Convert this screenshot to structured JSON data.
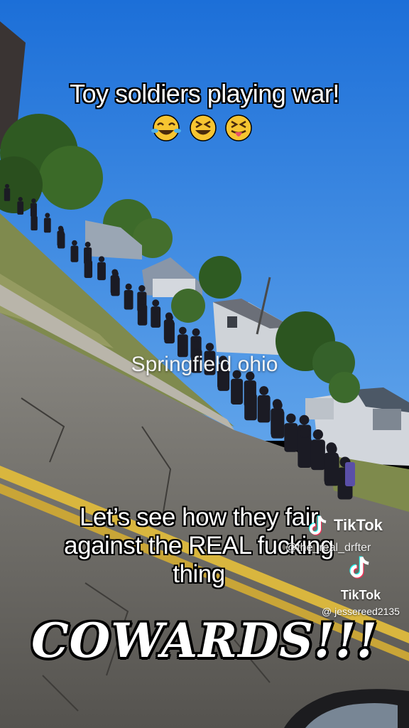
{
  "top_caption": "Toy soldiers playing war!",
  "emojis": [
    "😂",
    "😆",
    "😝"
  ],
  "location_text": "Springfield ohio",
  "bottom_caption_lines": [
    "Let’s see how they fair",
    "against the REAL fucking",
    "thing"
  ],
  "headline": "COWARDS!!!",
  "watermarks": [
    {
      "brand": "TikTok",
      "username": "@the_real_drfter"
    },
    {
      "brand": "TikTok",
      "username": "@ jessereed2135"
    }
  ],
  "icons": [
    "tiktok-logo-icon",
    "tiktok-logo-icon"
  ],
  "colors": {
    "sky": "#2d7fe0",
    "road": "#6f6d69",
    "grass": "#7f8a4e",
    "road_line": "#d9b63e"
  }
}
